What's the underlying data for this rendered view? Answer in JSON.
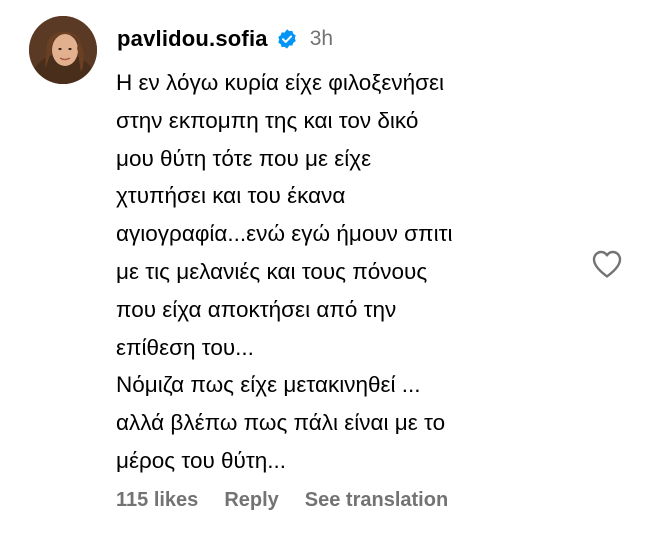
{
  "comment": {
    "username": "pavlidou.sofia",
    "verified_icon": "verified-badge-icon",
    "verified_color": "#0095f6",
    "time": "3h",
    "lines": [
      "Η εν λόγω κυρία είχε φιλοξενήσει",
      "στην εκπομπη της και τον δικό",
      "μου θύτη τότε που με είχε",
      "χτυπήσει και του έκανα",
      "αγιογραφία...ενώ εγώ ήμουν σπιτι",
      "με τις μελανιές και τους πόνους",
      "που είχα αποκτήσει από την",
      "επίθεση του...",
      "Νόμιζα πως είχε μετακινηθεί ...",
      "αλλά βλέπω πως πάλι είναι με το",
      "μέρος του θύτη..."
    ],
    "like_icon": "heart-outline-icon"
  },
  "footer": {
    "likes": "115 likes",
    "reply": "Reply",
    "see_translation": "See translation"
  }
}
